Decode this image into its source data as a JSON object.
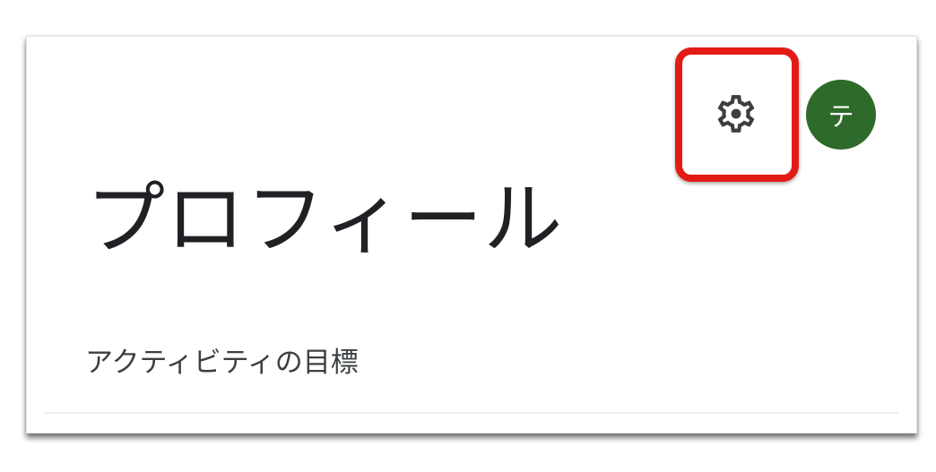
{
  "header": {
    "settings_icon": "gear-icon",
    "avatar_initial": "テ",
    "avatar_color": "#2e6a2a",
    "highlight_color": "#e31b17"
  },
  "main": {
    "title": "プロフィール",
    "section_label": "アクティビティの目標"
  }
}
